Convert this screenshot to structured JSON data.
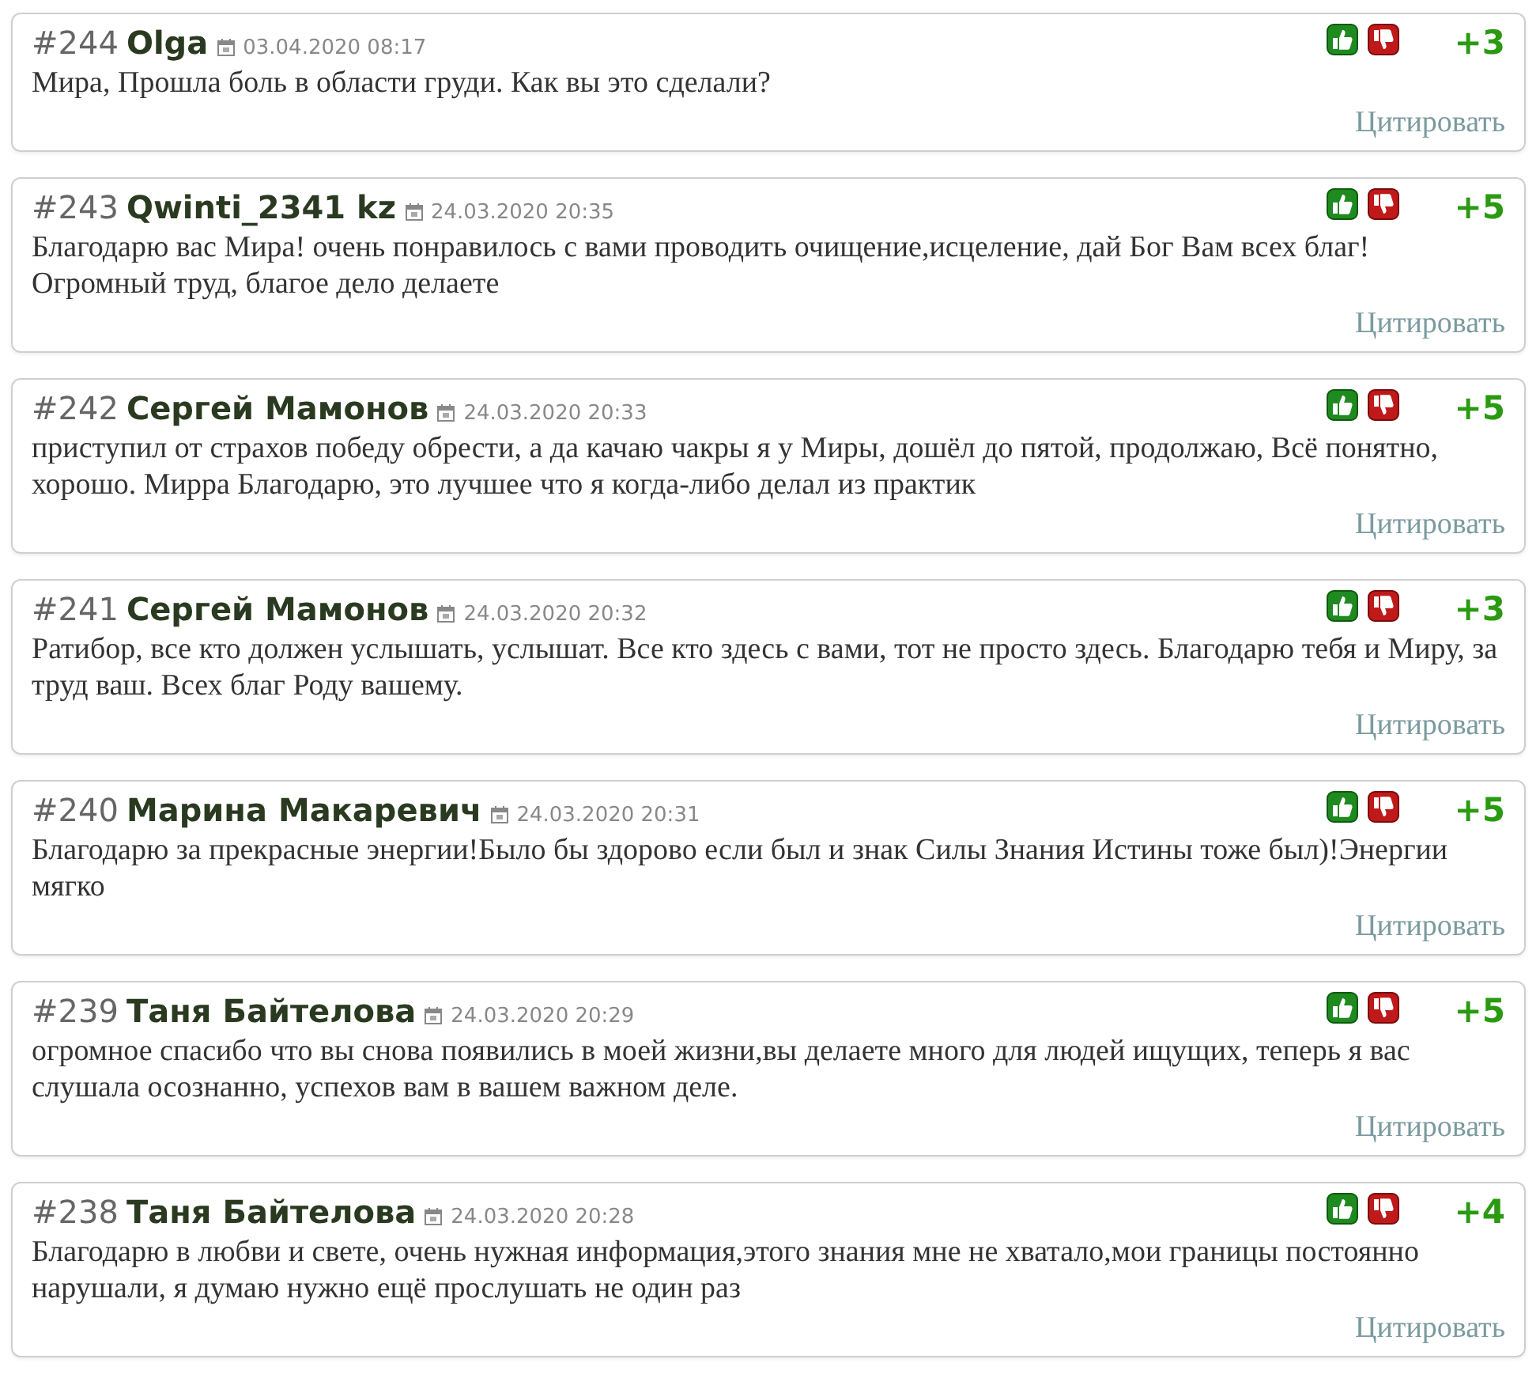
{
  "comments": [
    {
      "number": "#244",
      "author": "Olga",
      "date": "03.04.2020 08:17",
      "score": "+3",
      "text": "Мира, Прошла боль в области груди. Как вы это сделали?",
      "quote": "Цитировать"
    },
    {
      "number": "#243",
      "author": "Qwinti_2341 kz",
      "date": "24.03.2020 20:35",
      "score": "+5",
      "text": "Благодарю вас Мира! очень понравилось с вами проводить очищение,исцеление, дай Бог Вам всех благ! Огромный труд, благое дело делаете",
      "quote": "Цитировать"
    },
    {
      "number": "#242",
      "author": "Сергей Мамонов",
      "date": "24.03.2020 20:33",
      "score": "+5",
      "text": "приступил от страхов победу обрести, а да качаю чакры я у Миры, дошёл до пятой, продолжаю, Всё понятно, хорошо. Мирра Благодарю, это лучшее что я когда-либо делал из практик",
      "quote": "Цитировать"
    },
    {
      "number": "#241",
      "author": "Сергей Мамонов",
      "date": "24.03.2020 20:32",
      "score": "+3",
      "text": "Ратибор, все кто должен услышать, услышат. Все кто здесь с вами, тот не просто здесь. Благодарю тебя и Миру, за труд ваш. Всех благ Роду вашему.",
      "quote": "Цитировать"
    },
    {
      "number": "#240",
      "author": "Марина Макаревич",
      "date": "24.03.2020 20:31",
      "score": "+5",
      "text": "Благодарю за прекрасные энергии!Было бы здорово если был и знак Силы Знания Истины тоже был)!Энергии мягко",
      "quote": "Цитировать"
    },
    {
      "number": "#239",
      "author": "Таня Байтелова",
      "date": "24.03.2020 20:29",
      "score": "+5",
      "text": "огромное спасибо что вы снова появились в моей жизни,вы делаете много для людей ищущих, теперь я вас слушала осознанно, успехов вам в вашем важном деле.",
      "quote": "Цитировать"
    },
    {
      "number": "#238",
      "author": "Таня Байтелова",
      "date": "24.03.2020 20:28",
      "score": "+4",
      "text": "Благодарю в любви и свете, очень нужная информация,этого знания мне не хватало,мои границы постоянно нарушали, я думаю нужно ещё прослушать не один раз",
      "quote": "Цитировать"
    }
  ]
}
